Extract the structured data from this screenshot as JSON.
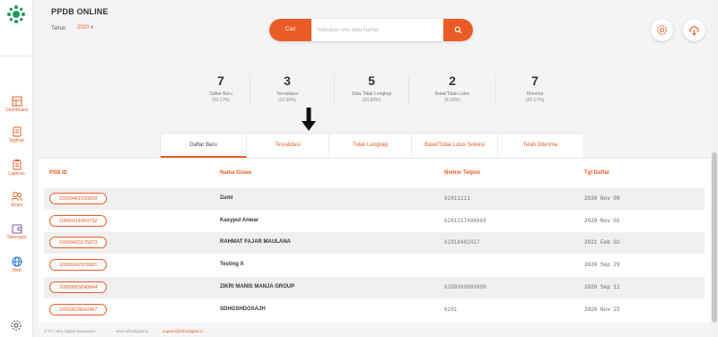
{
  "app": {
    "title": "PPDB ONLINE"
  },
  "filter": {
    "year_label": "Tahun",
    "year_value": "2020"
  },
  "search": {
    "button_label": "Cari",
    "placeholder": "Masukan NIS atau Nama"
  },
  "sidebar": {
    "items": [
      {
        "label": "Dashboard",
        "icon": "dashboard-icon"
      },
      {
        "label": "Tagihan",
        "icon": "invoice-icon"
      },
      {
        "label": "Laporan",
        "icon": "clipboard-icon"
      },
      {
        "label": "Siswa",
        "icon": "users-icon"
      },
      {
        "label": "Tabungan",
        "icon": "wallet-icon"
      },
      {
        "label": "Web",
        "icon": "globe-icon"
      }
    ]
  },
  "stats": [
    {
      "value": "7",
      "label": "Daftar Baru",
      "pct": "(29.17%)"
    },
    {
      "value": "3",
      "label": "Tervalidasi",
      "pct": "(12.50%)"
    },
    {
      "value": "5",
      "label": "Data Tidak Lengkap",
      "pct": "(20.83%)"
    },
    {
      "value": "2",
      "label": "Batal/Tidak Lulus",
      "pct": "(8.33%)"
    },
    {
      "value": "7",
      "label": "Diterima",
      "pct": "(29.17%)"
    }
  ],
  "tabs": [
    {
      "label": "Daftar Baru",
      "active": true
    },
    {
      "label": "Tervalidasi",
      "active": false
    },
    {
      "label": "Tidak Lengkap",
      "active": false
    },
    {
      "label": "Batal/Tidak Lulus Seleksi",
      "active": false
    },
    {
      "label": "Telah Diterima",
      "active": false
    }
  ],
  "table": {
    "headers": {
      "psb_id": "PSB ID",
      "name": "Nama Siswa",
      "phone": "Nomor Telpon",
      "date": "Tgl Daftar"
    },
    "rows": [
      {
        "psb_id": "10000461593659",
        "name": "Zumi",
        "phone": "62811111",
        "date": "2020 Nov 09"
      },
      {
        "psb_id": "10000114063732",
        "name": "Kasypul Anwar",
        "phone": "6281217406868",
        "date": "2020 Nov 01"
      },
      {
        "psb_id": "10000423175873",
        "name": "RAHMAT FAJAR MAULANA",
        "phone": "62818482427",
        "date": "2021 Feb 02"
      },
      {
        "psb_id": "10000142378901",
        "name": "Testing X",
        "phone": "",
        "date": "2020 Sep 29"
      },
      {
        "psb_id": "10000065848844",
        "name": "ZIKRI MANIS MANJA GROUP",
        "phone": "6289999999999",
        "date": "2020 Sep 11"
      },
      {
        "psb_id": "10000628843467",
        "name": "SDHGSHDGSAJH",
        "phone": "6281",
        "date": "2020 Nov 23"
      }
    ]
  },
  "footer": {
    "company": "© PT. Infra Digital Nusantara",
    "website": "www.infradigital.io",
    "email": "support@infradigital.io"
  },
  "colors": {
    "accent": "#ea5b25",
    "logo_green": "#1e9a5a"
  }
}
